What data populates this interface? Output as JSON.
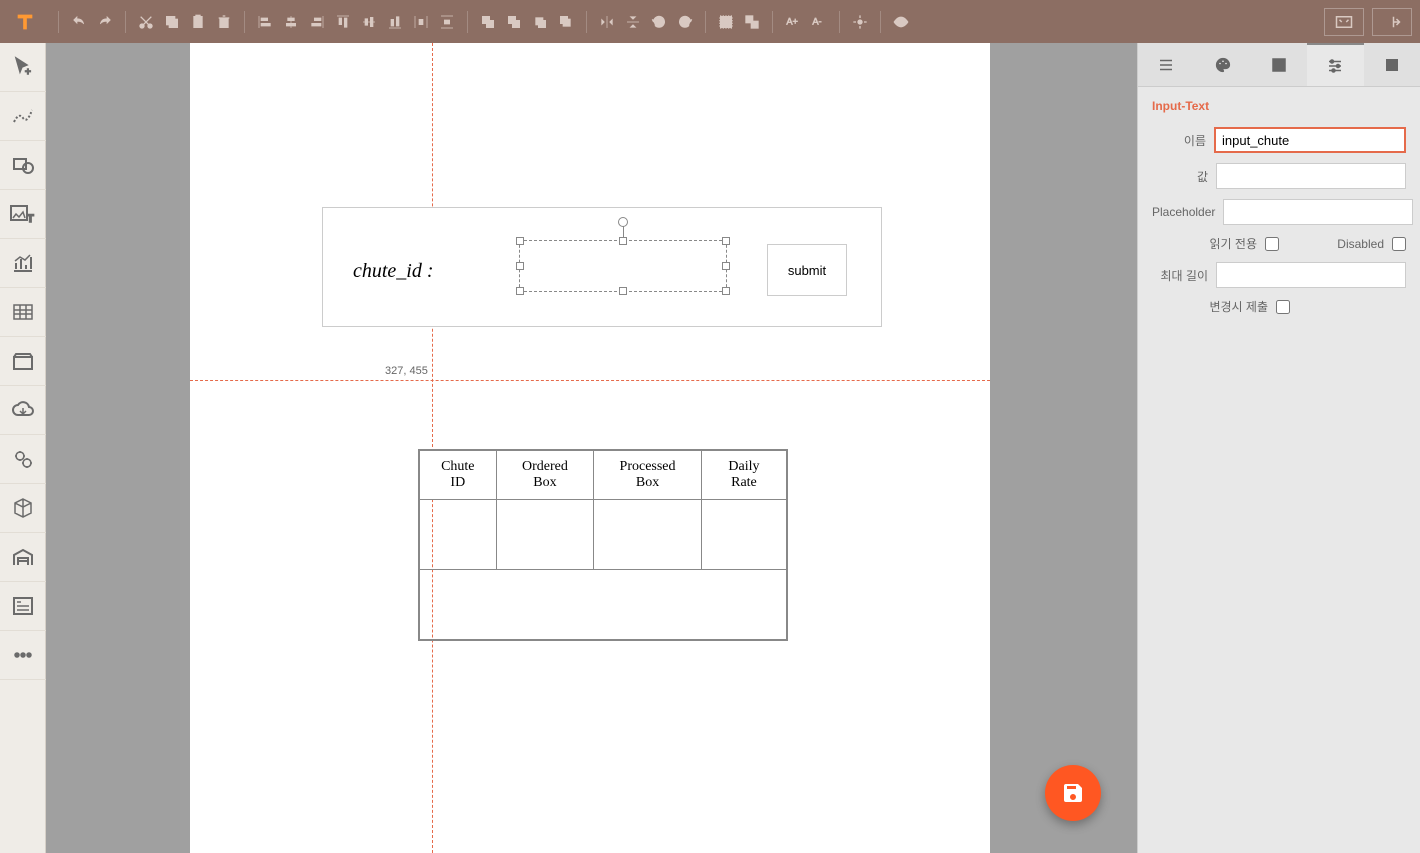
{
  "toolbar": {
    "logo": "T"
  },
  "canvas": {
    "form": {
      "label": "chute_id :",
      "submit_label": "submit"
    },
    "coord_text": "327, 455",
    "table": {
      "headers": [
        "Chute ID",
        "Ordered Box",
        "Processed Box",
        "Daily Rate"
      ]
    }
  },
  "properties": {
    "title": "Input-Text",
    "labels": {
      "name": "이름",
      "value": "값",
      "placeholder": "Placeholder",
      "readonly": "읽기 전용",
      "disabled": "Disabled",
      "maxlength": "최대 길이",
      "submit_on_change": "변경시 제출"
    },
    "values": {
      "name": "input_chute",
      "value": "",
      "placeholder": "",
      "maxlength": ""
    }
  }
}
